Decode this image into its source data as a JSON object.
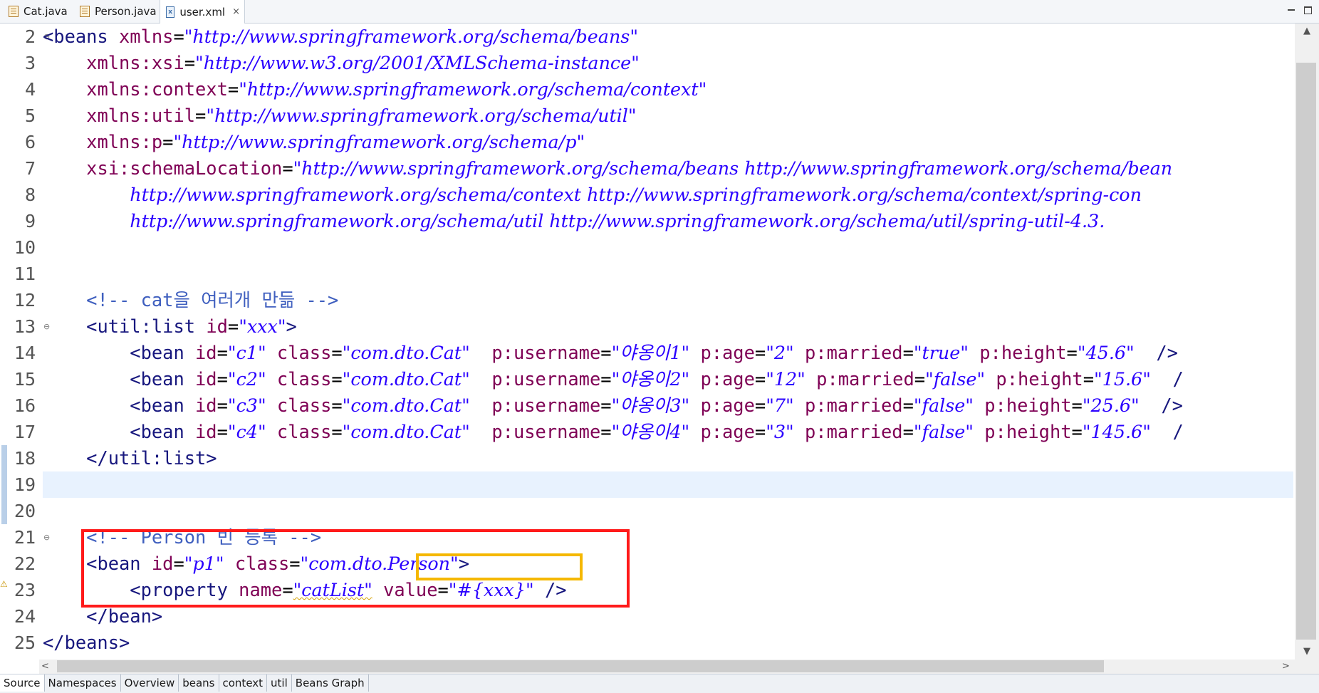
{
  "tabs": [
    {
      "label": "Cat.java",
      "icon": "java-file-icon",
      "active": false
    },
    {
      "label": "Person.java",
      "icon": "java-file-icon",
      "active": false
    },
    {
      "label": "user.xml",
      "icon": "xml-file-icon",
      "active": true,
      "close": "×"
    }
  ],
  "editor": {
    "line_numbers": [
      "2",
      "3",
      "4",
      "5",
      "6",
      "7",
      "8",
      "9",
      "10",
      "11",
      "12",
      "13",
      "14",
      "15",
      "16",
      "17",
      "18",
      "19",
      "20",
      "21",
      "22",
      "23",
      "24",
      "25"
    ],
    "current_line": "19",
    "code": {
      "l2": {
        "tag_open": "<beans ",
        "attr": "xmlns",
        "eq": "=",
        "val": "\"http://www.springframework.org/schema/beans\""
      },
      "l3": {
        "attr": "xmlns:xsi",
        "eq": "=",
        "val": "\"http://www.w3.org/2001/XMLSchema-instance\""
      },
      "l4": {
        "attr": "xmlns:context",
        "eq": "=",
        "val": "\"http://www.springframework.org/schema/context\""
      },
      "l5": {
        "attr": "xmlns:util",
        "eq": "=",
        "val": "\"http://www.springframework.org/schema/util\""
      },
      "l6": {
        "attr": "xmlns:p",
        "eq": "=",
        "val": "\"http://www.springframework.org/schema/p\""
      },
      "l7": {
        "attr": "xsi:schemaLocation",
        "eq": "=",
        "val": "\"http://www.springframework.org/schema/beans http://www.springframework.org/schema/bean"
      },
      "l8": {
        "val": "http://www.springframework.org/schema/context http://www.springframework.org/schema/context/spring-con"
      },
      "l9": {
        "val": "http://www.springframework.org/schema/util http://www.springframework.org/schema/util/spring-util-4.3."
      },
      "l12": {
        "comment": "<!-- cat을 여러개 만듦 -->"
      },
      "l13": {
        "tag_open": "<util:list ",
        "attr": "id",
        "eq": "=",
        "val": "\"xxx\"",
        "tag_close": ">"
      },
      "l14": {
        "tag_open": "<bean ",
        "id_attr": "id",
        "id_val": "\"c1\"",
        "class_attr": "class",
        "class_val": "\"com.dto.Cat\"",
        "user_attr": "p:username",
        "user_val": "\"야옹이1\"",
        "age_attr": "p:age",
        "age_val": "\"2\"",
        "mar_attr": "p:married",
        "mar_val": "\"true\"",
        "h_attr": "p:height",
        "h_val": "\"45.6\"",
        "end": "/>"
      },
      "l15": {
        "tag_open": "<bean ",
        "id_attr": "id",
        "id_val": "\"c2\"",
        "class_attr": "class",
        "class_val": "\"com.dto.Cat\"",
        "user_attr": "p:username",
        "user_val": "\"야옹이2\"",
        "age_attr": "p:age",
        "age_val": "\"12\"",
        "mar_attr": "p:married",
        "mar_val": "\"false\"",
        "h_attr": "p:height",
        "h_val": "\"15.6\"",
        "end": "/"
      },
      "l16": {
        "tag_open": "<bean ",
        "id_attr": "id",
        "id_val": "\"c3\"",
        "class_attr": "class",
        "class_val": "\"com.dto.Cat\"",
        "user_attr": "p:username",
        "user_val": "\"야옹이3\"",
        "age_attr": "p:age",
        "age_val": "\"7\"",
        "mar_attr": "p:married",
        "mar_val": "\"false\"",
        "h_attr": "p:height",
        "h_val": "\"25.6\"",
        "end": "/>"
      },
      "l17": {
        "tag_open": "<bean ",
        "id_attr": "id",
        "id_val": "\"c4\"",
        "class_attr": "class",
        "class_val": "\"com.dto.Cat\"",
        "user_attr": "p:username",
        "user_val": "\"야옹이4\"",
        "age_attr": "p:age",
        "age_val": "\"3\"",
        "mar_attr": "p:married",
        "mar_val": "\"false\"",
        "h_attr": "p:height",
        "h_val": "\"145.6\"",
        "end": "/"
      },
      "l18": {
        "tag": "</util:list>"
      },
      "l20": {
        "comment": "<!-- Person 빈 등록 -->"
      },
      "l21": {
        "tag_open": "<bean ",
        "id_attr": "id",
        "id_val": "\"p1\"",
        "class_attr": "class",
        "class_val": "\"com.dto.Person\"",
        "tag_close": ">"
      },
      "l22": {
        "tag_open": "<property ",
        "name_attr": "name",
        "name_val": "\"catList\"",
        "value_attr": "value",
        "value_val": "\"#{xxx}\"",
        "end": "/>"
      },
      "l23": {
        "tag": "</bean>"
      },
      "l24": {
        "tag": "</beans>"
      }
    }
  },
  "scroll": {
    "up": "▲",
    "down": "▼",
    "left": "<",
    "right": ">"
  },
  "bottom_tabs": [
    "Source",
    "Namespaces",
    "Overview",
    "beans",
    "context",
    "util",
    "Beans Graph"
  ],
  "colors": {
    "tag": "#17177e",
    "attribute": "#7f0055",
    "value": "#2a00ff",
    "comment": "#3f5fbf",
    "highlight_red": "#ff1a1a",
    "highlight_orange": "#f5b800"
  }
}
